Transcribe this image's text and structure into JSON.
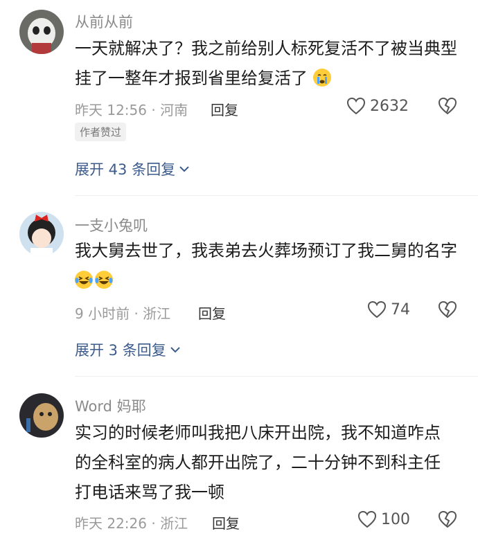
{
  "comments": [
    {
      "username": "从前从前",
      "text": "一天就解决了？我之前给别人标死复活不了被当典型挂了一整年才报到省里给复活了",
      "emoji": "crying-emoji",
      "time": "昨天 12:56",
      "location": "河南",
      "reply_label": "回复",
      "likes": "2632",
      "badge": "作者赞过",
      "expand": "展开 43 条回复"
    },
    {
      "username": "一支小兔叽",
      "text": "我大舅去世了，我表弟去火葬场预订了我二舅的名字",
      "emoji": "laughing-tears-emoji",
      "time": "9 小时前",
      "location": "浙江",
      "reply_label": "回复",
      "likes": "74",
      "expand": "展开 3 条回复"
    },
    {
      "username": "Word 妈耶",
      "text": "实习的时候老师叫我把八床开出院，我不知道咋点的全科室的病人都开出院了，二十分钟不到科主任打电话来骂了我一顿",
      "time": "昨天 22:26",
      "location": "浙江",
      "reply_label": "回复",
      "likes": "100"
    }
  ],
  "colors": {
    "link": "#3b5b8c",
    "muted": "#9a9a9a",
    "text": "#1c1c1c"
  }
}
